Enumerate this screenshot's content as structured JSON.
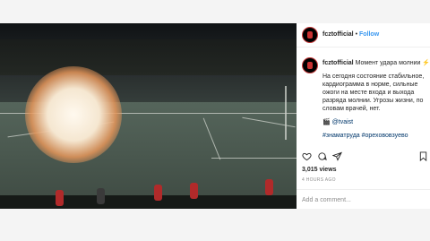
{
  "post": {
    "username": "fcztofficial",
    "follow_label": "Follow",
    "caption_first": "Момент удара молнии",
    "caption_emoji": "⚡",
    "paragraph": "На сегодня состояние стабильное, кардиограмма в норме, сильные ожоги на месте входа и выхода разряда молнии. Угрозы жизни, по словам врачей, нет.",
    "credit_icon": "🎬",
    "credit": "@tvaist",
    "hashtags": "#знаматруда #орехововзуево",
    "views": "3,015 views",
    "time": "4 HOURS AGO",
    "comment_placeholder": "Add a comment..."
  },
  "colors": {
    "accent": "#3897f0",
    "brand_red": "#c83232"
  },
  "icons": [
    "heart-icon",
    "comment-icon",
    "share-icon",
    "bookmark-icon"
  ]
}
